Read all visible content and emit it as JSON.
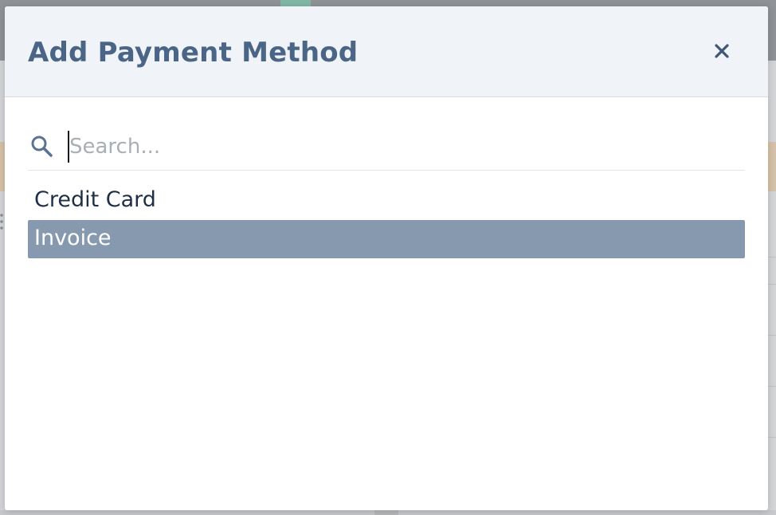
{
  "modal": {
    "title": "Add Payment Method",
    "close_icon": "close-icon"
  },
  "search": {
    "icon": "search-icon",
    "value": "",
    "placeholder": "Search..."
  },
  "options": [
    {
      "label": "Credit Card",
      "selected": false
    },
    {
      "label": "Invoice",
      "selected": true
    }
  ],
  "colors": {
    "title": "#4a6585",
    "selected_bg": "#8799ae",
    "header_bg": "#f0f4f8"
  }
}
